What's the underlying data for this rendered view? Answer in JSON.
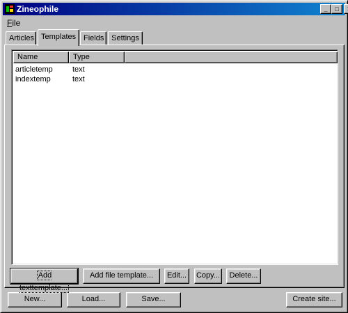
{
  "window": {
    "title": "Zineophile",
    "minimize_glyph": "_",
    "maximize_glyph": "□",
    "close_glyph": "✕"
  },
  "menu": {
    "file_mnemonic": "F",
    "file_rest": "ile"
  },
  "tabs": [
    {
      "label": "Articles",
      "active": false
    },
    {
      "label": "Templates",
      "active": true
    },
    {
      "label": "Fields",
      "active": false
    },
    {
      "label": "Settings",
      "active": false
    }
  ],
  "list": {
    "columns": [
      "Name",
      "Type",
      ""
    ],
    "rows": [
      {
        "name": "articletemp",
        "type": "text"
      },
      {
        "name": "indextemp",
        "type": "text"
      }
    ]
  },
  "panel_buttons": {
    "add_text_template": "Add texttemplate...",
    "add_file_template": "Add file template...",
    "edit": "Edit...",
    "copy": "Copy...",
    "delete": "Delete..."
  },
  "bottom_buttons": {
    "new": "New...",
    "load": "Load...",
    "save": "Save...",
    "create_site": "Create site..."
  },
  "colors": {
    "titlebar_start": "#000080",
    "titlebar_end": "#1084d0",
    "face": "#c0c0c0",
    "list_bg": "#ffffff"
  }
}
